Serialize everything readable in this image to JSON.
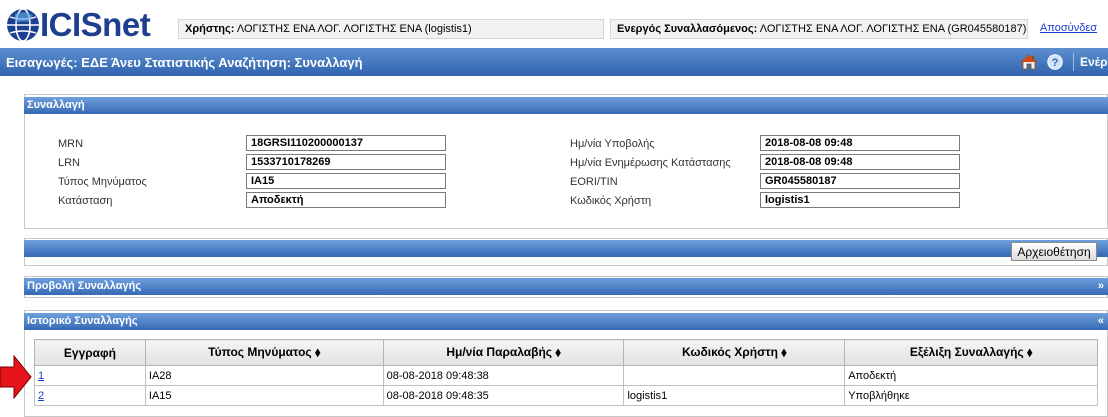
{
  "header": {
    "logo_text": "ICISnet",
    "user_label": "Χρήστης:",
    "user_value": "ΛΟΓΙΣΤΗΣ ΕΝΑ ΛΟΓ. ΛΟΓΙΣΤΗΣ ΕΝΑ (logistis1)",
    "trader_label": "Ενεργός Συναλλασόμενος:",
    "trader_value": "ΛΟΓΙΣΤΗΣ ΕΝΑ ΛΟΓ. ΛΟΓΙΣΤΗΣ ΕΝΑ (GR045580187)",
    "logout_label": "Αποσύνδεσ"
  },
  "titlebar": {
    "title": "Εισαγωγές: ΕΔΕ Άνευ Στατιστικής Αναζήτηση: Συναλλαγή",
    "home_icon": "home-icon",
    "help_icon": "help-icon",
    "actions_label": "Ενέργειες"
  },
  "transaction_panel": {
    "title": "Συναλλαγή",
    "left_fields": [
      {
        "label": "MRN",
        "value": "18GRSI110200000137"
      },
      {
        "label": "LRN",
        "value": "1533710178269"
      },
      {
        "label": "Τύπος Μηνύματος",
        "value": "IA15"
      },
      {
        "label": "Κατάσταση",
        "value": "Αποδεκτή"
      }
    ],
    "right_fields": [
      {
        "label": "Ημ/νία Υποβολής",
        "value": "2018-08-08 09:48"
      },
      {
        "label": "Ημ/νία Ενημέρωσης Κατάστασης",
        "value": "2018-08-08 09:48"
      },
      {
        "label": "EORI/TIN",
        "value": "GR045580187"
      },
      {
        "label": "Κωδικός Χρήστη",
        "value": "logistis1"
      }
    ]
  },
  "archive_button_label": "Αρχειοθέτηση",
  "view_panel": {
    "title": "Προβολή Συναλλαγής",
    "toggle": "»"
  },
  "history_panel": {
    "title": "Ιστορικό Συναλλαγής",
    "toggle": "«",
    "columns": [
      "Εγγραφή",
      "Τύπος Μηνύματος ⬧",
      "Ημ/νία Παραλαβής ⬧",
      "Κωδικός Χρήστη ⬧",
      "Εξέλιξη Συναλλαγής ⬧"
    ],
    "rows": [
      [
        "1",
        "IA28",
        "08-08-2018 09:48:38",
        "",
        "Αποδεκτή"
      ],
      [
        "2",
        "IA15",
        "08-08-2018 09:48:35",
        "logistis1",
        "Υποβλήθηκε"
      ]
    ]
  },
  "colors": {
    "header_blue": "#2f63ad",
    "link_blue": "#1a3fcf",
    "arrow_red": "#e8141c"
  }
}
